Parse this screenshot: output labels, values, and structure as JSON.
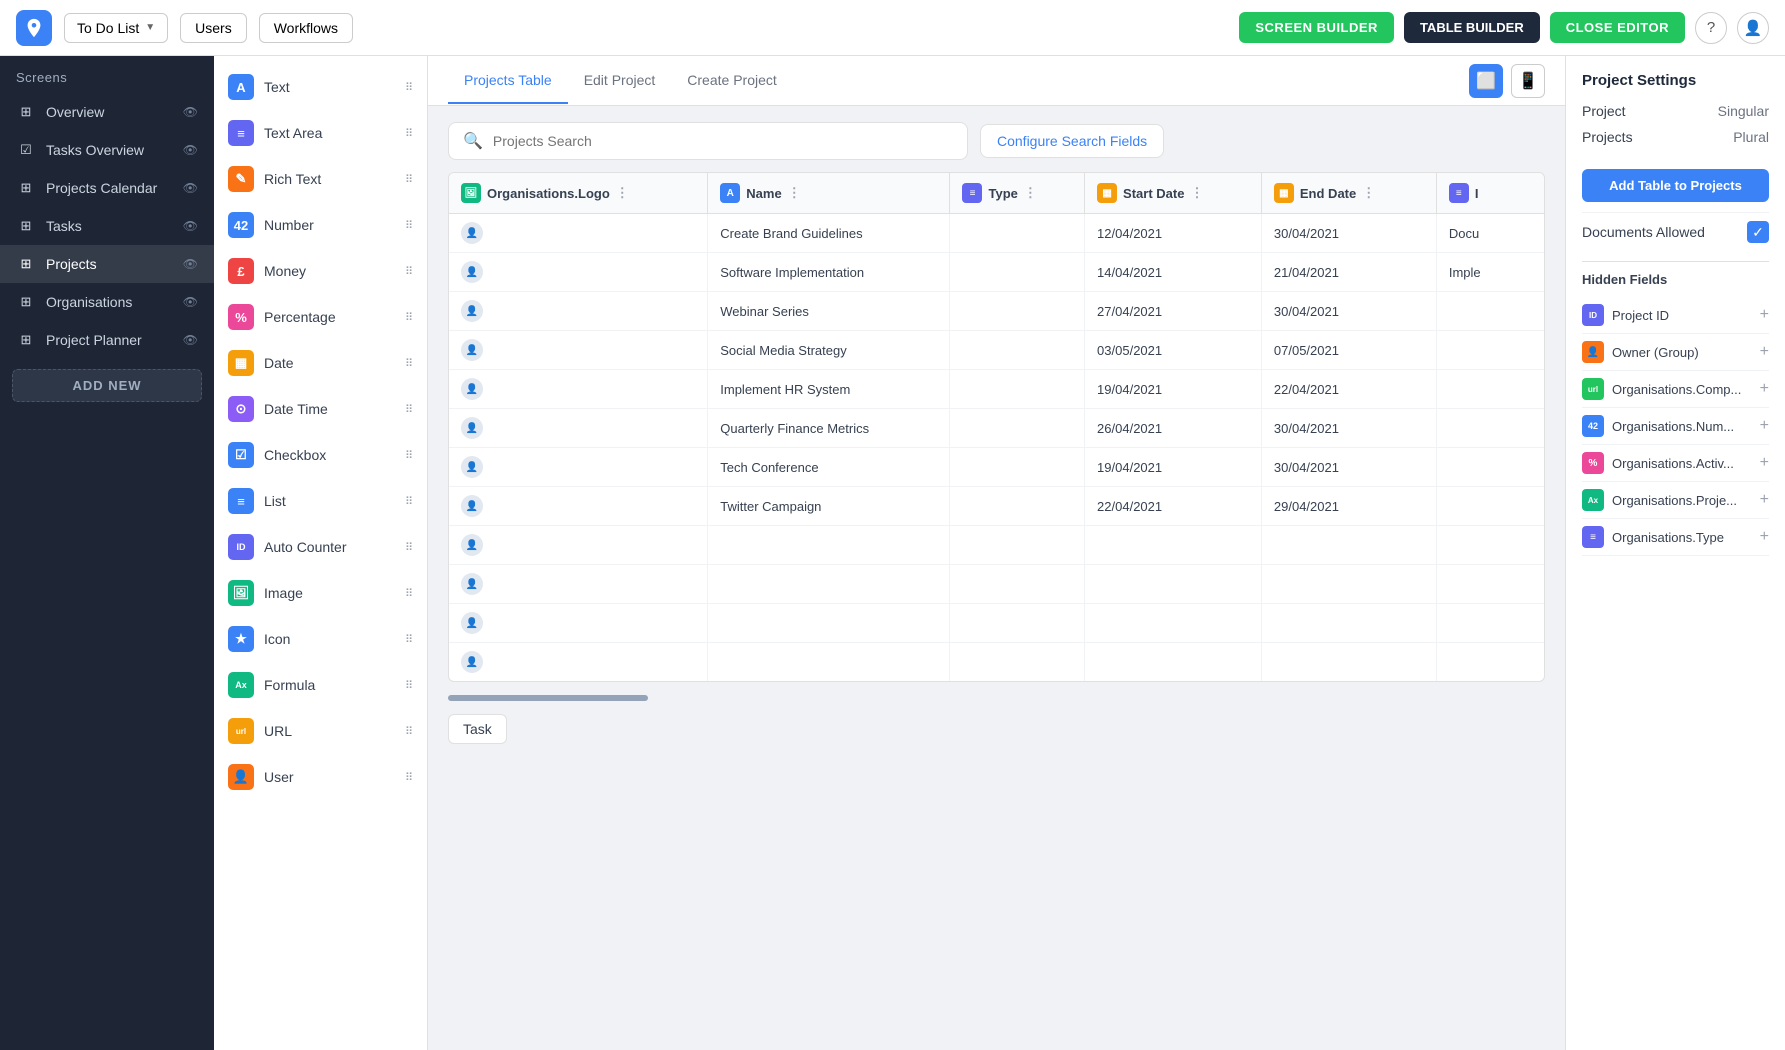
{
  "topbar": {
    "dropdown_label": "To Do List",
    "users_btn": "Users",
    "workflows_btn": "Workflows",
    "screen_builder_btn": "SCREEN BUILDER",
    "table_builder_btn": "TABLE BUILDER",
    "close_editor_btn": "CLOSE EDITOR"
  },
  "sidebar": {
    "title": "Screens",
    "items": [
      {
        "label": "Overview",
        "icon": "⊞",
        "active": false
      },
      {
        "label": "Tasks Overview",
        "icon": "✓⊞",
        "active": false
      },
      {
        "label": "Projects Calendar",
        "icon": "▦",
        "active": false
      },
      {
        "label": "Tasks",
        "icon": "▦",
        "active": false
      },
      {
        "label": "Projects",
        "icon": "▦",
        "active": true
      },
      {
        "label": "Organisations",
        "icon": "▦",
        "active": false
      },
      {
        "label": "Project Planner",
        "icon": "▦",
        "active": false
      }
    ],
    "add_new_btn": "ADD NEW"
  },
  "field_types": [
    {
      "label": "Text",
      "icon_class": "fi-text",
      "icon_text": "A"
    },
    {
      "label": "Text Area",
      "icon_class": "fi-textarea",
      "icon_text": "≡"
    },
    {
      "label": "Rich Text",
      "icon_class": "fi-richtext",
      "icon_text": "✎"
    },
    {
      "label": "Number",
      "icon_class": "fi-number",
      "icon_text": "42"
    },
    {
      "label": "Money",
      "icon_class": "fi-money",
      "icon_text": "£"
    },
    {
      "label": "Percentage",
      "icon_class": "fi-pct",
      "icon_text": "%"
    },
    {
      "label": "Date",
      "icon_class": "fi-date",
      "icon_text": "▦"
    },
    {
      "label": "Date Time",
      "icon_class": "fi-datetime",
      "icon_text": "⊙"
    },
    {
      "label": "Checkbox",
      "icon_class": "fi-check",
      "icon_text": "☑"
    },
    {
      "label": "List",
      "icon_class": "fi-list",
      "icon_text": "≡"
    },
    {
      "label": "Auto Counter",
      "icon_class": "fi-auto",
      "icon_text": "ID"
    },
    {
      "label": "Image",
      "icon_class": "fi-image",
      "icon_text": "⛰"
    },
    {
      "label": "Icon",
      "icon_class": "fi-icon2",
      "icon_text": "★"
    },
    {
      "label": "Formula",
      "icon_class": "fi-formula",
      "icon_text": "Ax"
    },
    {
      "label": "URL",
      "icon_class": "fi-url",
      "icon_text": "url"
    },
    {
      "label": "User",
      "icon_class": "fi-user",
      "icon_text": "👤"
    }
  ],
  "tabs": [
    {
      "label": "Projects Table",
      "active": true
    },
    {
      "label": "Edit Project",
      "active": false
    },
    {
      "label": "Create Project",
      "active": false
    }
  ],
  "search": {
    "placeholder": "Projects Search",
    "configure_btn": "Configure Search Fields"
  },
  "table": {
    "columns": [
      {
        "label": "Organisations.Logo",
        "icon_bg": "#10b981",
        "icon_text": "⛰"
      },
      {
        "label": "Name",
        "icon_bg": "#3b82f6",
        "icon_text": "A"
      },
      {
        "label": "Type",
        "icon_bg": "#6366f1",
        "icon_text": "≡"
      },
      {
        "label": "Start Date",
        "icon_bg": "#f59e0b",
        "icon_text": "▦"
      },
      {
        "label": "End Date",
        "icon_bg": "#f59e0b",
        "icon_text": "▦"
      },
      {
        "label": "I",
        "icon_bg": "#6366f1",
        "icon_text": "≡"
      }
    ],
    "rows": [
      {
        "name": "Create Brand Guidelines",
        "type": "",
        "start_date": "12/04/2021",
        "end_date": "30/04/2021",
        "extra": "Docu"
      },
      {
        "name": "Software Implementation",
        "type": "",
        "start_date": "14/04/2021",
        "end_date": "21/04/2021",
        "extra": "Imple"
      },
      {
        "name": "Webinar Series",
        "type": "",
        "start_date": "27/04/2021",
        "end_date": "30/04/2021",
        "extra": ""
      },
      {
        "name": "Social Media Strategy",
        "type": "",
        "start_date": "03/05/2021",
        "end_date": "07/05/2021",
        "extra": ""
      },
      {
        "name": "Implement HR System",
        "type": "",
        "start_date": "19/04/2021",
        "end_date": "22/04/2021",
        "extra": ""
      },
      {
        "name": "Quarterly Finance Metrics",
        "type": "",
        "start_date": "26/04/2021",
        "end_date": "30/04/2021",
        "extra": ""
      },
      {
        "name": "Tech Conference",
        "type": "",
        "start_date": "19/04/2021",
        "end_date": "30/04/2021",
        "extra": ""
      },
      {
        "name": "Twitter Campaign",
        "type": "",
        "start_date": "22/04/2021",
        "end_date": "29/04/2021",
        "extra": ""
      },
      {
        "name": "",
        "type": "",
        "start_date": "",
        "end_date": "",
        "extra": ""
      },
      {
        "name": "",
        "type": "",
        "start_date": "",
        "end_date": "",
        "extra": ""
      },
      {
        "name": "",
        "type": "",
        "start_date": "",
        "end_date": "",
        "extra": ""
      },
      {
        "name": "",
        "type": "",
        "start_date": "",
        "end_date": "",
        "extra": ""
      }
    ]
  },
  "bottom_tag": "Task",
  "right_panel": {
    "title": "Project Settings",
    "singular_label": "Project",
    "singular_value": "Singular",
    "plural_label": "Projects",
    "plural_value": "Plural",
    "add_table_btn": "Add Table to Projects",
    "docs_allowed_label": "Documents Allowed",
    "hidden_fields_title": "Hidden Fields",
    "hidden_fields": [
      {
        "label": "Project ID",
        "icon_class": "hfi-id",
        "icon_text": "ID"
      },
      {
        "label": "Owner (Group)",
        "icon_class": "hfi-owner",
        "icon_text": "👤"
      },
      {
        "label": "Organisations.Comp...",
        "icon_class": "hfi-comp",
        "icon_text": "url"
      },
      {
        "label": "Organisations.Num...",
        "icon_class": "hfi-num",
        "icon_text": "42"
      },
      {
        "label": "Organisations.Activ...",
        "icon_class": "hfi-activ",
        "icon_text": "%"
      },
      {
        "label": "Organisations.Proje...",
        "icon_class": "hfi-proj",
        "icon_text": "Ax"
      },
      {
        "label": "Organisations.Type",
        "icon_class": "hfi-type",
        "icon_text": "≡"
      }
    ]
  }
}
